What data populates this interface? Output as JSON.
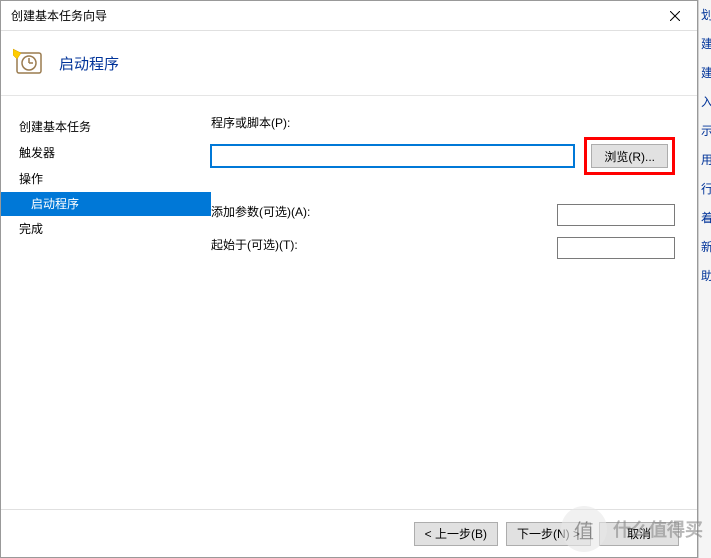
{
  "titlebar": {
    "title": "创建基本任务向导"
  },
  "header": {
    "title": "启动程序"
  },
  "sidebar": {
    "items": [
      {
        "label": "创建基本任务"
      },
      {
        "label": "触发器"
      },
      {
        "label": "操作"
      },
      {
        "label": "启动程序",
        "sub": true,
        "selected": true
      },
      {
        "label": "完成"
      }
    ]
  },
  "form": {
    "program_label": "程序或脚本(P):",
    "program_value": "",
    "browse_label": "浏览(R)...",
    "args_label": "添加参数(可选)(A):",
    "args_value": "",
    "startin_label": "起始于(可选)(T):",
    "startin_value": ""
  },
  "footer": {
    "back": "< 上一步(B)",
    "next": "下一步(N) >",
    "cancel": "取消"
  },
  "right_panel": {
    "items": [
      "划",
      "建",
      "建",
      "入",
      "示",
      "用",
      "行",
      "着",
      "新",
      "助"
    ]
  },
  "watermark": {
    "text": "什么值得买",
    "icon": "值"
  }
}
